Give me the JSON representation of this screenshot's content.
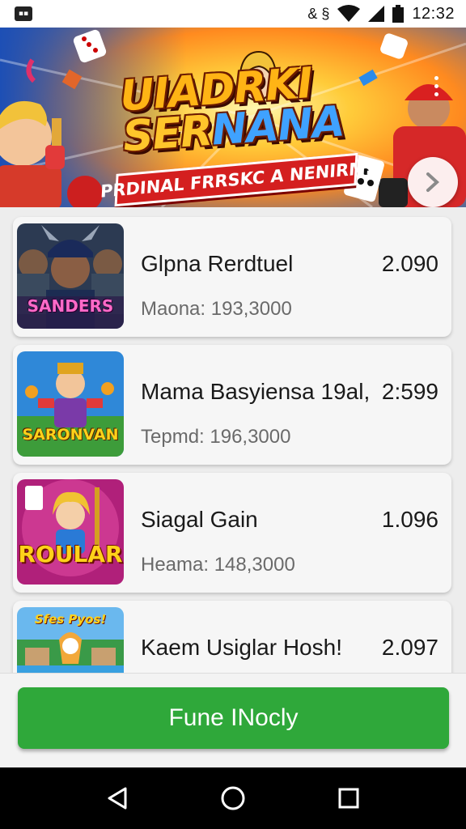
{
  "status_bar": {
    "notification_icon": "notification-icon",
    "network_label": "& §",
    "time": "12:32"
  },
  "banner": {
    "title_line1": "UIADRKI",
    "title_line2a": "SER",
    "title_line2b": "NANA",
    "subtitle": "PRDINAL FRRSKC A NENIRM.",
    "next_icon": "chevron-right-icon"
  },
  "games": [
    {
      "name": "Glpna Rerdtuel",
      "score": "2.090",
      "meta": "Maona: 193,3000",
      "thumb_text": "SANDERS"
    },
    {
      "name": "Mama Basyiensa 19al,",
      "score": "2:599",
      "meta": "Tepmd: 196,3000",
      "thumb_text": "SARONVAN"
    },
    {
      "name": "Siagal Gain",
      "score": "1.096",
      "meta": "Heama: 148,3000",
      "thumb_text": "ROULAR"
    },
    {
      "name": "Kaem Usiglar Hosh!",
      "score": "2.097",
      "meta": "",
      "thumb_text": "Sfes Pyos!"
    }
  ],
  "action": {
    "button_label": "Fune INocly"
  },
  "nav": {
    "back_icon": "back-icon",
    "home_icon": "home-icon",
    "recents_icon": "recents-icon"
  },
  "colors": {
    "accent_green": "#2fa83a",
    "banner_red": "#d41f1f",
    "title_gold": "#ffb415"
  }
}
